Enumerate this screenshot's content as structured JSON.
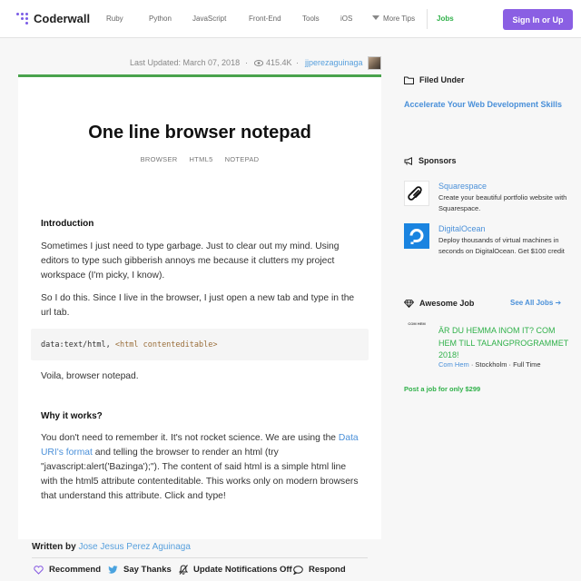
{
  "nav": {
    "brand": "Coderwall",
    "links": [
      "Ruby",
      "Python",
      "JavaScript",
      "Front-End",
      "Tools",
      "iOS"
    ],
    "more": "More Tips",
    "jobs": "Jobs",
    "signin": "Sign In or Up",
    "accent": "#8a5fe3"
  },
  "meta": {
    "updated": "Last Updated: March 07, 2018",
    "sep": "·",
    "views": "415.4K",
    "user": "jjperezaguinaga"
  },
  "article": {
    "title": "One line browser notepad",
    "tags": [
      "BROWSER",
      "HTML5",
      "NOTEPAD"
    ],
    "h_intro": "Introduction",
    "p1": "Sometimes I just need to type garbage. Just to clear out my mind. Using editors to type such gibberish annoys me because it clutters my project workspace (I'm picky, I know).",
    "p2": "So I do this. Since I live in the browser, I just open a new tab and type in the url tab.",
    "code_a": "data:text/html, ",
    "code_b": "<html contenteditable>",
    "p3": "Voila, browser notepad.",
    "h_why": "Why it works?",
    "p4_a": "You don't need to remember it. It's not rocket science. We are using the ",
    "p4_link": "Data URI's format",
    "p4_b": " and telling the browser to render an html (try \"javascript:alert('Bazinga');\"). The content of said html is a simple html line with the html5 attribute contenteditable. This works only on modern browsers that understand this attribute. Click and type!",
    "accent": "#4aa34c"
  },
  "author": {
    "label": "Written by",
    "name": "Jose Jesus Perez Aguinaga"
  },
  "actions": {
    "recommend": "Recommend",
    "tweet": "Say Thanks",
    "notify": "Update Notifications Off",
    "respond": "Respond"
  },
  "sidebar": {
    "filed_under": "Filed Under",
    "filed_link": "Accelerate Your Web Development Skills",
    "sponsors": "Sponsors",
    "sponsor1_name": "Squarespace",
    "sponsor1_desc": "Create your beautiful portfolio website with Squarespace.",
    "sponsor2_name": "DigitalOcean",
    "sponsor2_desc": "Deploy thousands of virtual machines in seconds on DigitalOcean. Get $100 credit",
    "awesome_job": "Awesome Job",
    "see_all": "See All Jobs",
    "job_logo": "COM HEM",
    "job_title": "ÄR DU HEMMA INOM IT? COM HEM TILL TALANGPROGRAMMET 2018!",
    "job_company": "Com Hem",
    "job_location": " · Stockholm · Full Time",
    "post_job": "Post a job for only $299"
  }
}
